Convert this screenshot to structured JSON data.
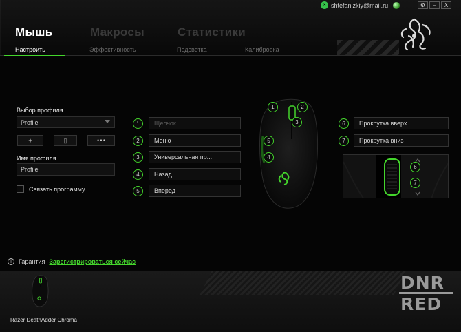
{
  "account": {
    "notification_count": "3",
    "email": "shtefanizkiy@mail.ru"
  },
  "window_buttons": {
    "settings": "⚙",
    "minimize": "–",
    "close": "X"
  },
  "nav": {
    "top_tabs": [
      "Мышь",
      "Макросы",
      "Статистики"
    ],
    "sub_tabs": [
      "Настроить",
      "Эффективность",
      "Подсветка",
      "Калибровка"
    ]
  },
  "profile": {
    "select_label": "Выбор профиля",
    "selected": "Profile",
    "add_button": "+",
    "delete_button": "▯",
    "more_button": "• • •",
    "name_label": "Имя профиля",
    "name_value": "Profile",
    "link_program_label": "Связать программу"
  },
  "buttons_left": [
    {
      "num": "1",
      "action": "Щелчок"
    },
    {
      "num": "2",
      "action": "Меню"
    },
    {
      "num": "3",
      "action": "Универсальная пр..."
    },
    {
      "num": "4",
      "action": "Назад"
    },
    {
      "num": "5",
      "action": "Вперед"
    }
  ],
  "buttons_right": [
    {
      "num": "6",
      "action": "Прокрутка вверх"
    },
    {
      "num": "7",
      "action": "Прокрутка вниз"
    }
  ],
  "mouse_callouts": [
    "1",
    "2",
    "3",
    "5",
    "4"
  ],
  "wheel_callouts": [
    "6",
    "7"
  ],
  "footer": {
    "warranty_label": "Гарантия",
    "register_link": "Зарегистрироваться сейчас",
    "device_name": "Razer DeathAdder Chroma"
  },
  "watermark": {
    "line1": "DNR",
    "line2": "RED"
  },
  "colors": {
    "accent": "#44d62c",
    "background": "#050505",
    "field": "#0e0e0e",
    "dim_text": "#6b6b6b"
  }
}
